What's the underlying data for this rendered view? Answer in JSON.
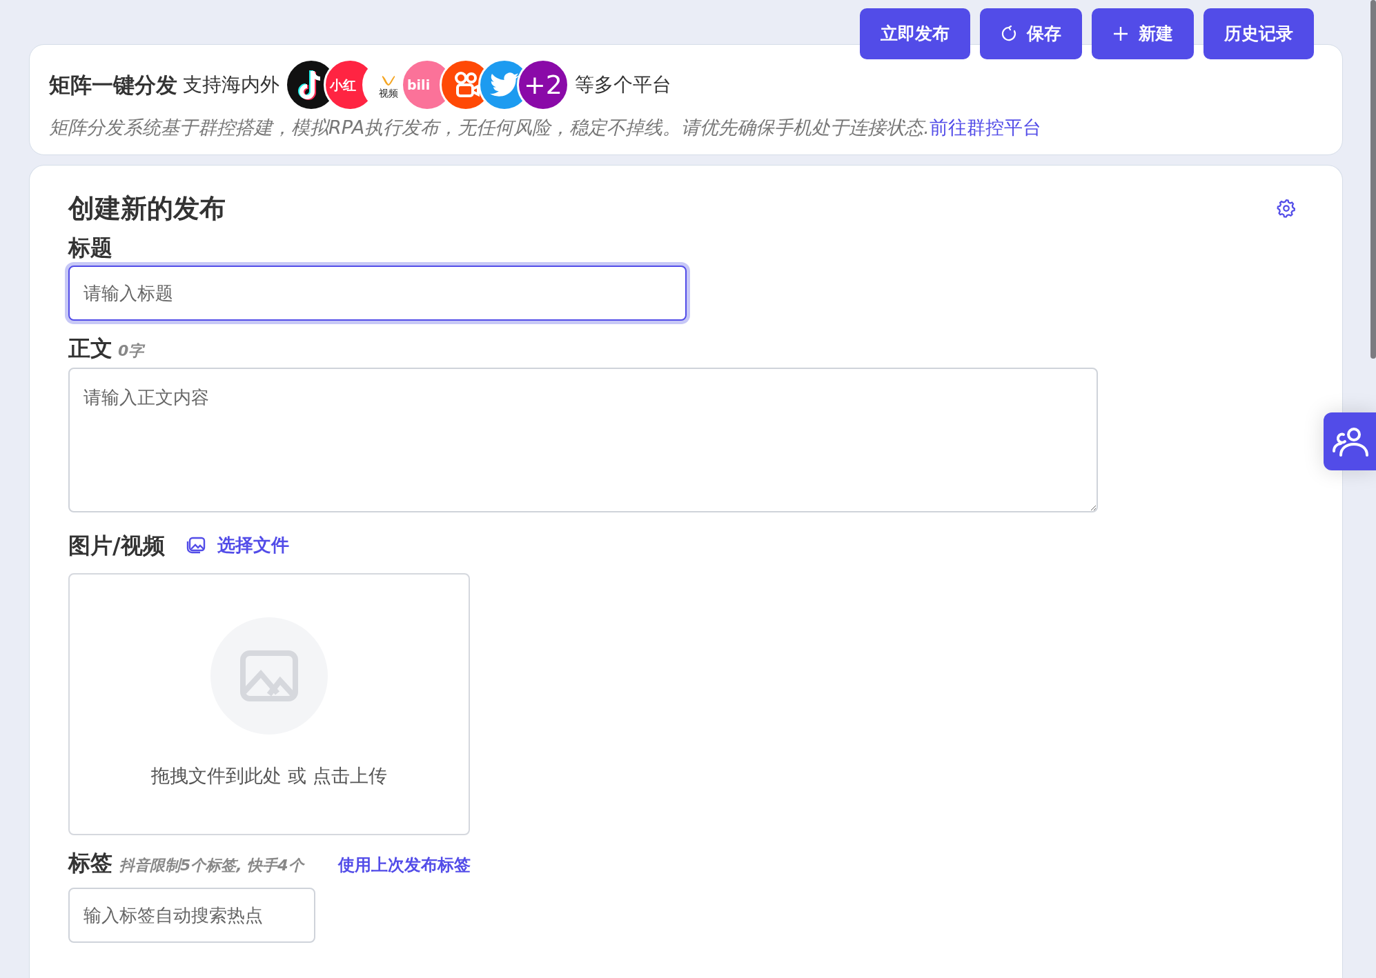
{
  "toolbar": [
    {
      "label": "立即发布",
      "kind": "plain"
    },
    {
      "label": "保存",
      "kind": "refresh"
    },
    {
      "label": "新建",
      "kind": "plus"
    },
    {
      "label": "历史记录",
      "kind": "plain"
    }
  ],
  "banner": {
    "title": "矩阵一键分发",
    "lead": "支持海内外",
    "platforms": [
      {
        "kind": "tiktok",
        "color": "#111111"
      },
      {
        "kind": "xiaohongshu",
        "color": "#ff2442",
        "label": "小红"
      },
      {
        "kind": "channels",
        "color": "#ffffff",
        "label": "视频"
      },
      {
        "kind": "bilibili",
        "color": "#fb7299",
        "label": "bili"
      },
      {
        "kind": "kuaishou",
        "color": "#ff4906"
      },
      {
        "kind": "twitter",
        "color": "#1d9bf0"
      },
      {
        "kind": "more",
        "color": "#8a0aa8",
        "label": "+2"
      }
    ],
    "tail": "等多个平台",
    "description": "矩阵分发系统基于群控搭建，模拟RPA执行发布，无任何风险，稳定不掉线。请优先确保手机处于连接状态.",
    "link": "前往群控平台"
  },
  "form": {
    "heading": "创建新的发布",
    "title_field": {
      "label": "标题",
      "placeholder": "请输入标题",
      "focused": true
    },
    "body_field": {
      "label": "正文",
      "count": "0字",
      "placeholder": "请输入正文内容"
    },
    "media": {
      "label": "图片/视频",
      "choose": "选择文件",
      "drop_hint": "拖拽文件到此处 或 点击上传"
    },
    "tags": {
      "label": "标签",
      "hint": "抖音限制5个标签, 快手4个",
      "reuse": "使用上次发布标签",
      "placeholder": "输入标签自动搜索热点"
    }
  }
}
